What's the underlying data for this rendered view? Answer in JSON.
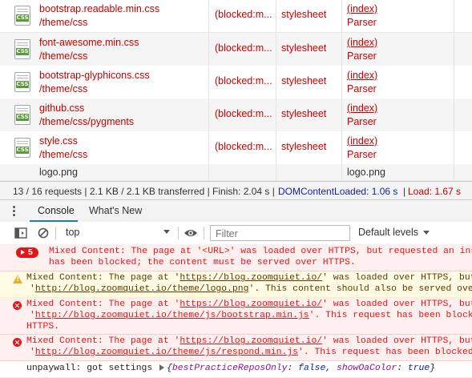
{
  "network": {
    "rows": [
      {
        "name": "bootstrap.readable.min.css",
        "path": "/theme/css",
        "status": "(blocked:m...",
        "type": "stylesheet",
        "initiator": "(index)",
        "initiator_type": "Parser",
        "icon": "css-file-icon",
        "icon_label": "CSS"
      },
      {
        "name": "font-awesome.min.css",
        "path": "/theme/css",
        "status": "(blocked:m...",
        "type": "stylesheet",
        "initiator": "(index)",
        "initiator_type": "Parser",
        "icon": "css-file-icon",
        "icon_label": "CSS"
      },
      {
        "name": "bootstrap-glyphicons.css",
        "path": "/theme/css",
        "status": "(blocked:m...",
        "type": "stylesheet",
        "initiator": "(index)",
        "initiator_type": "Parser",
        "icon": "css-file-icon",
        "icon_label": "CSS"
      },
      {
        "name": "github.css",
        "path": "/theme/css/pygments",
        "status": "(blocked:m...",
        "type": "stylesheet",
        "initiator": "(index)",
        "initiator_type": "Parser",
        "icon": "css-file-icon",
        "icon_label": "CSS"
      },
      {
        "name": "style.css",
        "path": "/theme/css",
        "status": "(blocked:m...",
        "type": "stylesheet",
        "initiator": "(index)",
        "initiator_type": "Parser",
        "icon": "css-file-icon",
        "icon_label": "CSS"
      },
      {
        "name": "logo.png",
        "initiator": "logo.png"
      }
    ],
    "summary": {
      "requests": "13 / 16 requests | 2.1 KB / 2.1 KB transferred | Finish: 2.04 s |",
      "dom_loaded": "DOMContentLoaded: 1.06 s",
      "sep": "|",
      "load": "Load: 1.67 s",
      "colors": {
        "dom": "#1a1aa6",
        "load": "#c80000"
      }
    }
  },
  "drawer": {
    "tabs": [
      {
        "label": "Console"
      },
      {
        "label": "What's New"
      }
    ],
    "menu_icon": "more-vertical-icon"
  },
  "toolbar": {
    "context": "top",
    "filter_placeholder": "Filter",
    "levels": "Default levels",
    "icons": [
      "sidebar-toggle-icon",
      "clear-console-icon",
      "eye-icon"
    ]
  },
  "console": {
    "group": {
      "count": "5",
      "line1": "Mixed Content: The page at '<URL>' was loaded over HTTPS, but requested an insec",
      "line2": "has been blocked; the content must be served over HTTPS."
    },
    "warning": {
      "a": "Mixed Content: The page at '",
      "page_url": "https://blog.zoomquiet.io/",
      "b": "' was loaded over HTTPS, but r",
      "c": "'",
      "res_url": "http://blog.zoomquiet.io/theme/logo.png",
      "d": "'. This content should also be served over H"
    },
    "errors": [
      {
        "a": "Mixed Content: The page at '",
        "page_url": "https://blog.zoomquiet.io/",
        "b": "' was loaded over HTTPS, but r",
        "c": "'",
        "res_url": "http://blog.zoomquiet.io/theme/js/bootstrap.min.js",
        "d": "'. This request has been blocked;",
        "e": "HTTPS."
      },
      {
        "a": "Mixed Content: The page at '",
        "page_url": "https://blog.zoomquiet.io/",
        "b": "' was loaded over HTTPS, but r",
        "c": "'",
        "res_url": "http://blog.zoomquiet.io/theme/js/respond.min.js",
        "d": "'. This request has been blocked; t"
      }
    ],
    "log": {
      "prefix": "unpaywall: got settings",
      "open": "{",
      "k1": "bestPracticeReposOnly",
      "colon1": ": ",
      "v1": "false",
      "comma": ", ",
      "k2": "showOaColor",
      "colon2": ": ",
      "v2": "true",
      "close": "}"
    }
  }
}
